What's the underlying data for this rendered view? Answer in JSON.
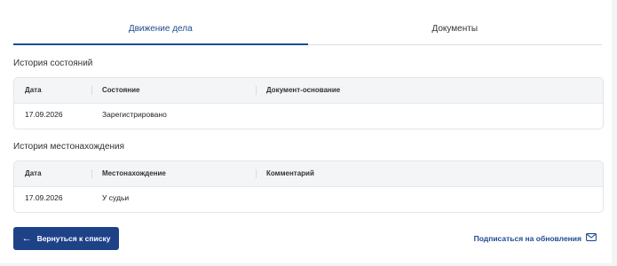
{
  "tabs": [
    {
      "label": "Движение дела",
      "active": true
    },
    {
      "label": "Документы",
      "active": false
    }
  ],
  "status_history": {
    "title": "История состояний",
    "columns": [
      "Дата",
      "Состояние",
      "Документ-основание"
    ],
    "rows": [
      [
        "17.09.2026",
        "Зарегистрировано",
        ""
      ]
    ]
  },
  "location_history": {
    "title": "История местонахождения",
    "columns": [
      "Дата",
      "Местонахождение",
      "Комментарий"
    ],
    "rows": [
      [
        "17.09.2026",
        "У судьи",
        ""
      ]
    ]
  },
  "actions": {
    "back_label": "Вернуться к списку",
    "subscribe_label": "Подписаться на обновления"
  },
  "icons": {
    "back": "arrow-left-icon",
    "subscribe": "mail-icon"
  },
  "colors": {
    "accent": "#1e4288",
    "link": "#1e4b91"
  }
}
